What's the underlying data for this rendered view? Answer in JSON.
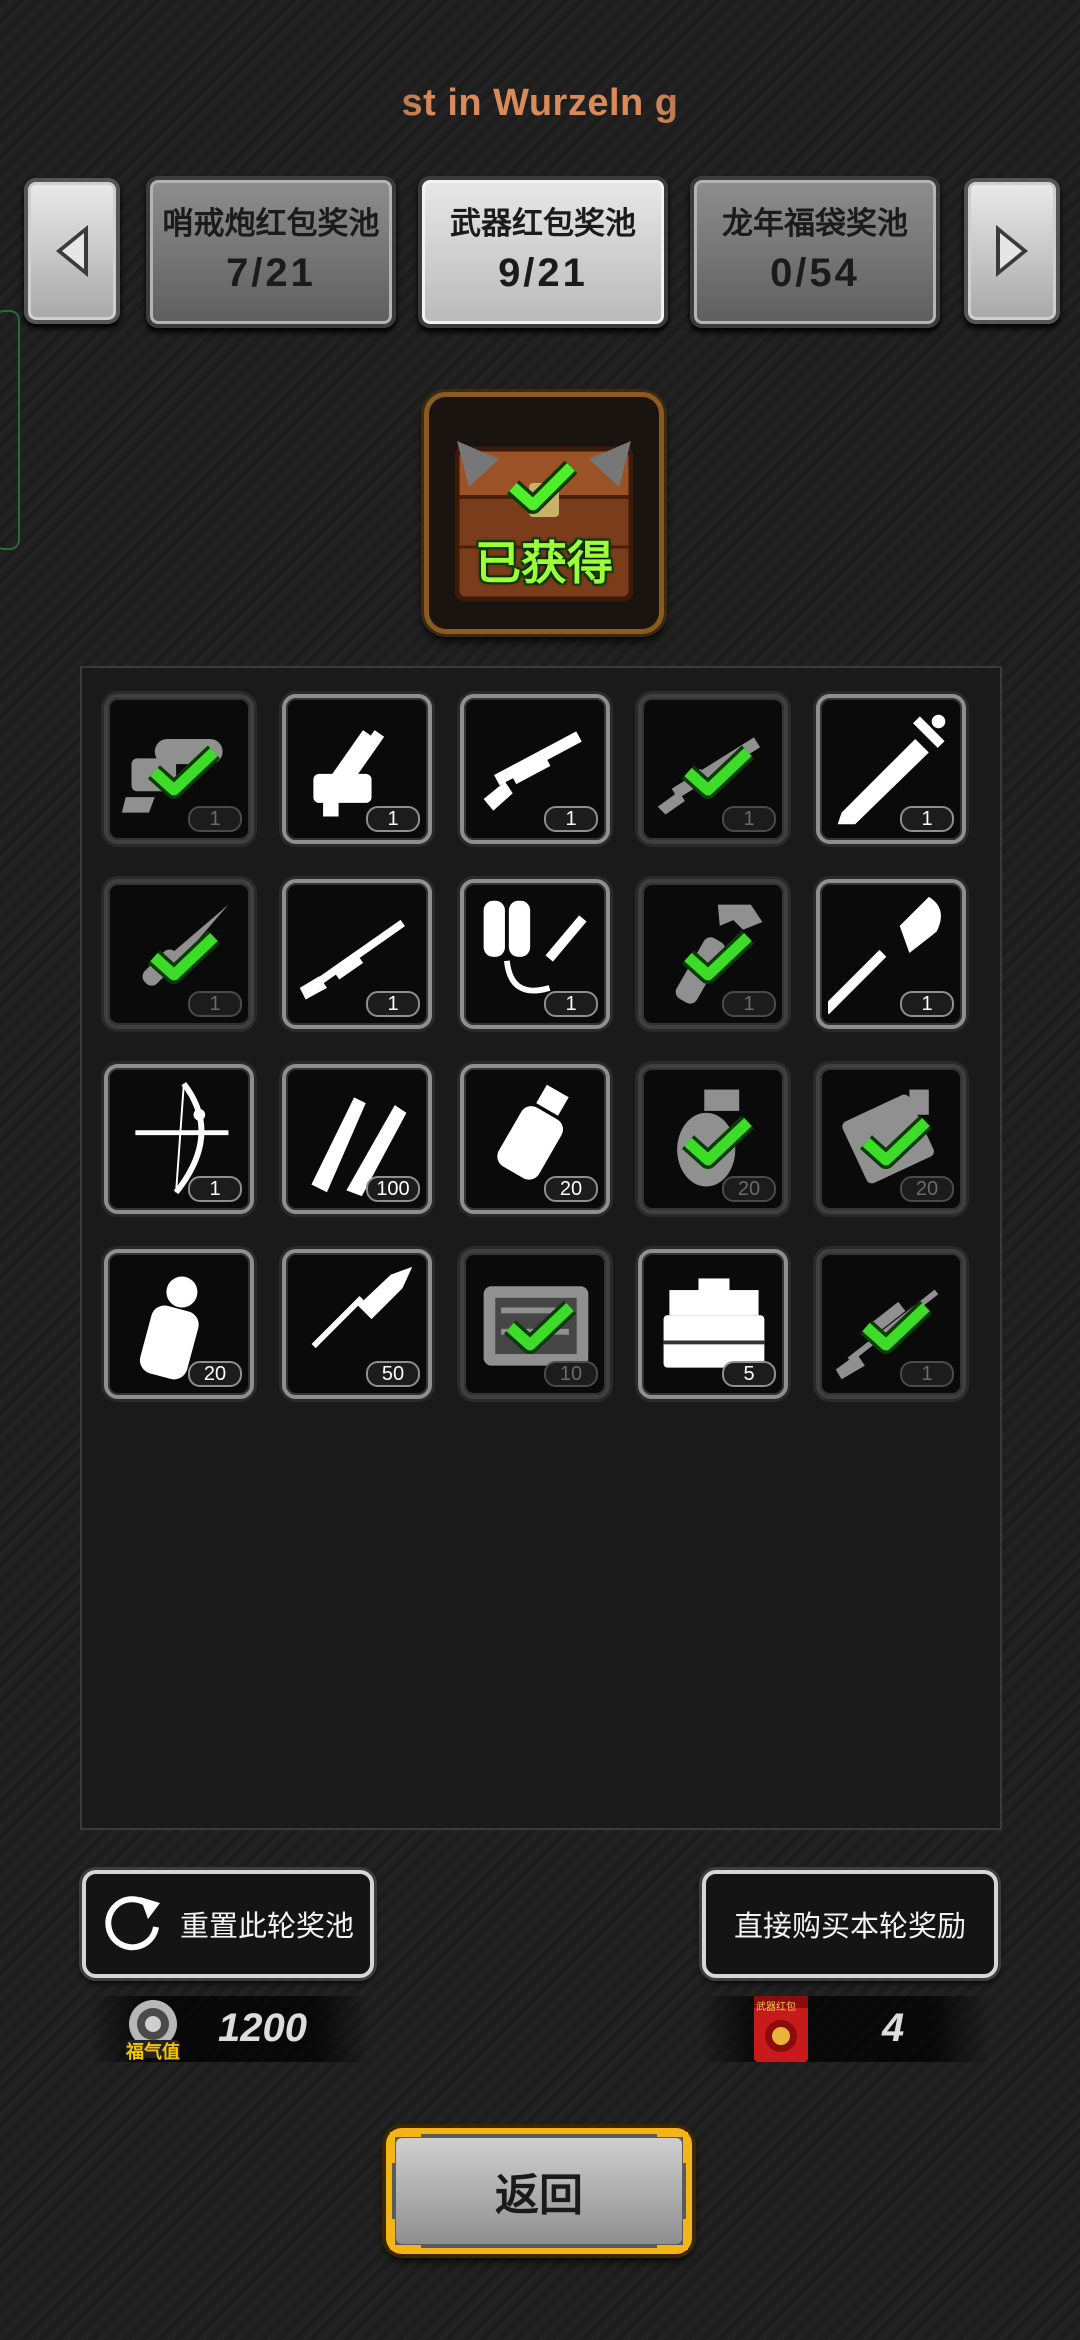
{
  "header": {
    "marquee_text": "st in Wurzeln g"
  },
  "tabs": [
    {
      "title": "哨戒炮红包奖池",
      "count": "7/21",
      "active": false
    },
    {
      "title": "武器红包奖池",
      "count": "9/21",
      "active": true
    },
    {
      "title": "龙年福袋奖池",
      "count": "0/54",
      "active": false
    }
  ],
  "chest": {
    "status_label": "已获得"
  },
  "items": [
    {
      "icon": "chainsaw-icon",
      "qty": "1",
      "obtained": true
    },
    {
      "icon": "minigun-icon",
      "qty": "1",
      "obtained": false
    },
    {
      "icon": "shotgun-icon",
      "qty": "1",
      "obtained": false
    },
    {
      "icon": "assault-rifle-icon",
      "qty": "1",
      "obtained": true
    },
    {
      "icon": "sword-icon",
      "qty": "1",
      "obtained": false
    },
    {
      "icon": "knife-icon",
      "qty": "1",
      "obtained": true
    },
    {
      "icon": "rifle-icon",
      "qty": "1",
      "obtained": false
    },
    {
      "icon": "flamethrower-icon",
      "qty": "1",
      "obtained": false
    },
    {
      "icon": "wrench-icon",
      "qty": "1",
      "obtained": true
    },
    {
      "icon": "shovel-icon",
      "qty": "1",
      "obtained": false
    },
    {
      "icon": "compound-bow-icon",
      "qty": "1",
      "obtained": false
    },
    {
      "icon": "bullets-icon",
      "qty": "100",
      "obtained": false
    },
    {
      "icon": "stun-grenade-icon",
      "qty": "20",
      "obtained": false
    },
    {
      "icon": "frag-grenade-icon",
      "qty": "20",
      "obtained": true
    },
    {
      "icon": "explosive-pack-icon",
      "qty": "20",
      "obtained": true
    },
    {
      "icon": "smoke-grenade-icon",
      "qty": "20",
      "obtained": false
    },
    {
      "icon": "rocket-icon",
      "qty": "50",
      "obtained": false
    },
    {
      "icon": "tool-case-icon",
      "qty": "10",
      "obtained": true
    },
    {
      "icon": "toolbox-icon",
      "qty": "5",
      "obtained": false
    },
    {
      "icon": "sniper-rifle-icon",
      "qty": "1",
      "obtained": true
    }
  ],
  "actions": {
    "reset_label": "重置此轮奖池",
    "buy_label": "直接购买本轮奖励"
  },
  "currency": {
    "fortune_label": "福气值",
    "fortune_value": "1200",
    "envelope_label": "武器红包",
    "envelope_value": "4"
  },
  "back_label": "返回",
  "colors": {
    "check_green": "#3cdc28",
    "gold_frame": "#f3b418",
    "chest_text": "#9dff3a"
  }
}
